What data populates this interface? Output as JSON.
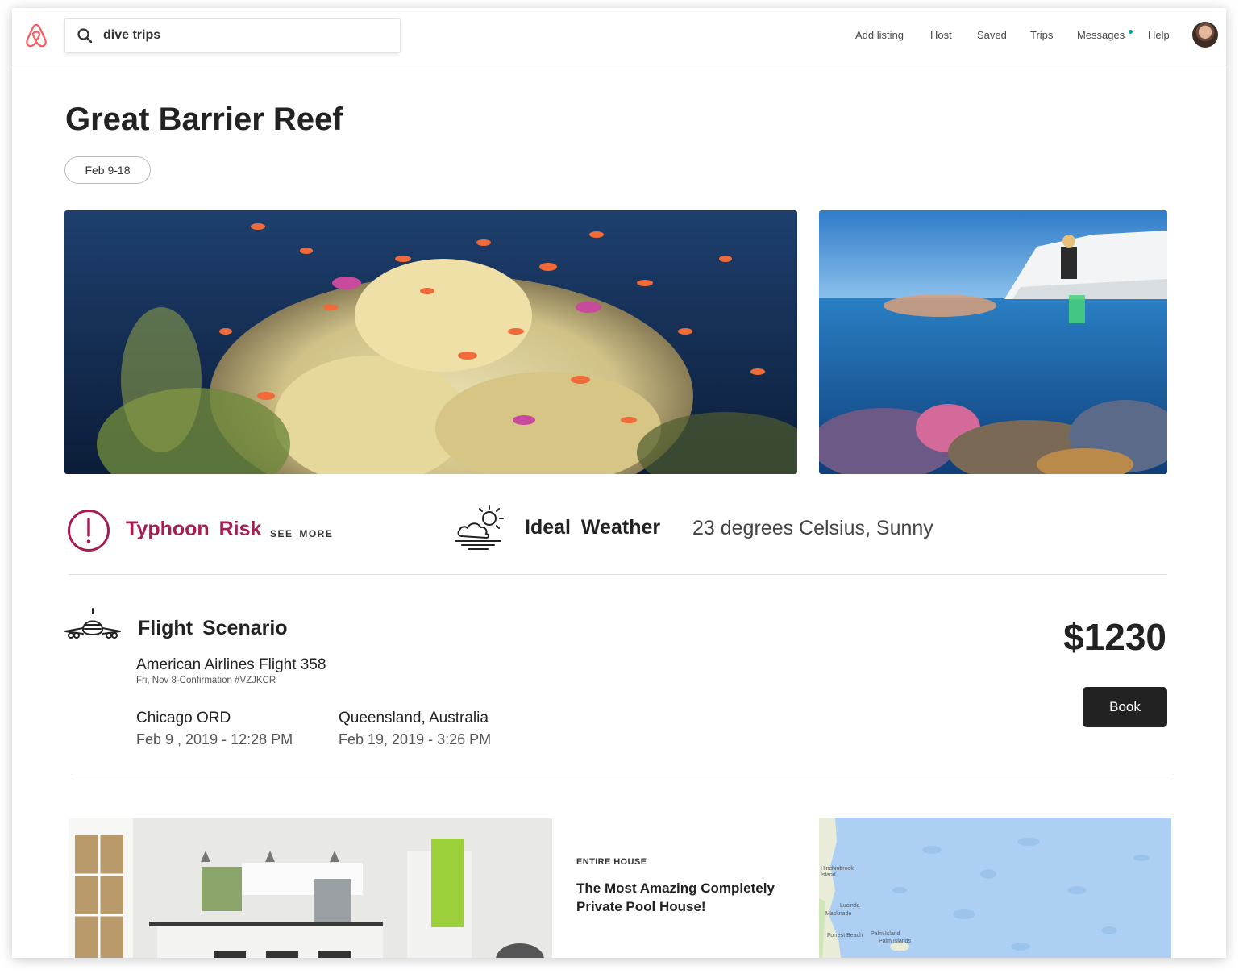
{
  "search": {
    "value": "dive trips"
  },
  "nav": {
    "add_listing": "Add listing",
    "host": "Host",
    "saved": "Saved",
    "trips": "Trips",
    "messages": "Messages",
    "help": "Help"
  },
  "trip": {
    "title": "Great Barrier Reef",
    "dates": "Feb 9-18"
  },
  "alerts": {
    "risk_label": "Typhoon Risk",
    "see_more": "SEE MORE",
    "weather_label": "Ideal Weather",
    "weather_detail": "23 degrees Celsius, Sunny"
  },
  "flight": {
    "label": "Flight Scenario",
    "airline": "American Airlines Flight 358",
    "confirmation": "Fri, Nov 8-Confirmation #VZJKCR",
    "depart_city": "Chicago ORD",
    "depart_time": "Feb 9 , 2019 - 12:28 PM",
    "arrive_city": "Queensland, Australia",
    "arrive_time": "Feb 19, 2019 - 3:26 PM",
    "price": "$1230",
    "book_label": "Book"
  },
  "listing": {
    "type": "ENTIRE HOUSE",
    "title": "The Most Amazing Completely Private Pool House!"
  },
  "map": {
    "labels": [
      "Hinchinbrook Island",
      "Lucinda",
      "Macknade",
      "Forrest Beach",
      "Palm Island",
      "Palm Islands"
    ]
  },
  "colors": {
    "brand": "#ff5a5f",
    "risk": "#a61d55",
    "notification_dot": "#00a699",
    "book_button": "#222222",
    "map_water": "#aecff4"
  },
  "icons": [
    "airbnb-logo",
    "search-icon",
    "avatar",
    "alert-icon",
    "partly-sunny-icon",
    "airplane-icon"
  ]
}
